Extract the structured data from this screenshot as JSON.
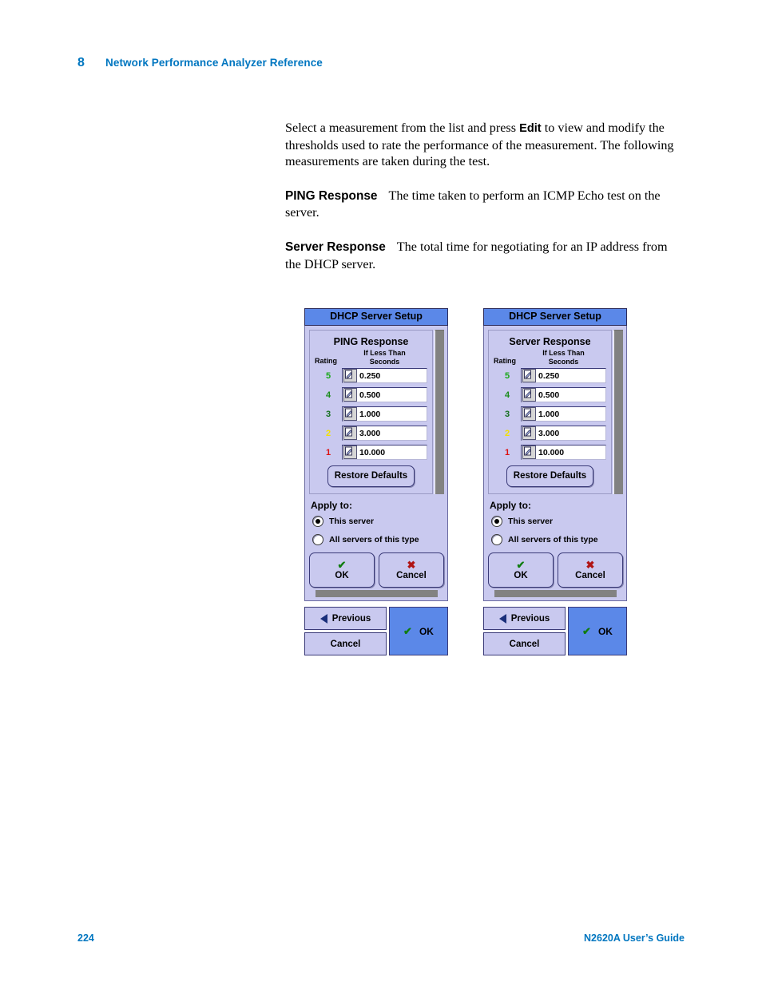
{
  "header": {
    "chapter_number": "8",
    "chapter_title": "Network Performance Analyzer Reference"
  },
  "footer": {
    "page_number": "224",
    "guide_title": "N2620A User’s Guide"
  },
  "body": {
    "intro_part1": "Select a measurement from the list and press ",
    "intro_bold": "Edit",
    "intro_part2": " to view and modify the thresholds used to rate the performance of the measurement. The following measurements are taken during the test.",
    "ping_term": "PING Response",
    "ping_desc": "The time taken to perform an ICMP Echo test on the server.",
    "server_term": "Server Response",
    "server_desc": "The total time for negotiating for an IP address from the DHCP server."
  },
  "colors": {
    "accent_blue": "#0076c0",
    "titlebar_blue": "#5b88e8",
    "panel_lavender": "#c9c9ef",
    "scrollbar_gray": "#828282",
    "rating_5": "#1aa81a",
    "rating_4": "#1a8c1a",
    "rating_3": "#15701f",
    "rating_2": "#f2e000",
    "rating_1": "#dd1111",
    "check_green": "#107c10",
    "x_red": "#b01414"
  },
  "dialogs": [
    {
      "title": "DHCP Server Setup",
      "measurement": "PING Response",
      "column_heads": {
        "rating": "Rating",
        "units_line1": "If Less Than",
        "units_line2": "Seconds"
      },
      "rows": [
        {
          "rating": "5",
          "value": "0.250",
          "color": "#1aa81a"
        },
        {
          "rating": "4",
          "value": "0.500",
          "color": "#1a8c1a"
        },
        {
          "rating": "3",
          "value": "1.000",
          "color": "#15701f"
        },
        {
          "rating": "2",
          "value": "3.000",
          "color": "#f2e000"
        },
        {
          "rating": "1",
          "value": "10.000",
          "color": "#dd1111"
        }
      ],
      "restore_label": "Restore Defaults",
      "apply_label": "Apply to:",
      "radios": [
        {
          "label": "This server",
          "selected": true
        },
        {
          "label": "All servers of this type",
          "selected": false
        }
      ],
      "ok_label": "OK",
      "cancel_label": "Cancel",
      "nav": {
        "previous_label": "Previous",
        "cancel_label": "Cancel",
        "ok_label": "OK"
      }
    },
    {
      "title": "DHCP Server Setup",
      "measurement": "Server Response",
      "column_heads": {
        "rating": "Rating",
        "units_line1": "If Less Than",
        "units_line2": "Seconds"
      },
      "rows": [
        {
          "rating": "5",
          "value": "0.250",
          "color": "#1aa81a"
        },
        {
          "rating": "4",
          "value": "0.500",
          "color": "#1a8c1a"
        },
        {
          "rating": "3",
          "value": "1.000",
          "color": "#15701f"
        },
        {
          "rating": "2",
          "value": "3.000",
          "color": "#f2e000"
        },
        {
          "rating": "1",
          "value": "10.000",
          "color": "#dd1111"
        }
      ],
      "restore_label": "Restore Defaults",
      "apply_label": "Apply to:",
      "radios": [
        {
          "label": "This server",
          "selected": true
        },
        {
          "label": "All servers of this type",
          "selected": false
        }
      ],
      "ok_label": "OK",
      "cancel_label": "Cancel",
      "nav": {
        "previous_label": "Previous",
        "cancel_label": "Cancel",
        "ok_label": "OK"
      }
    }
  ]
}
